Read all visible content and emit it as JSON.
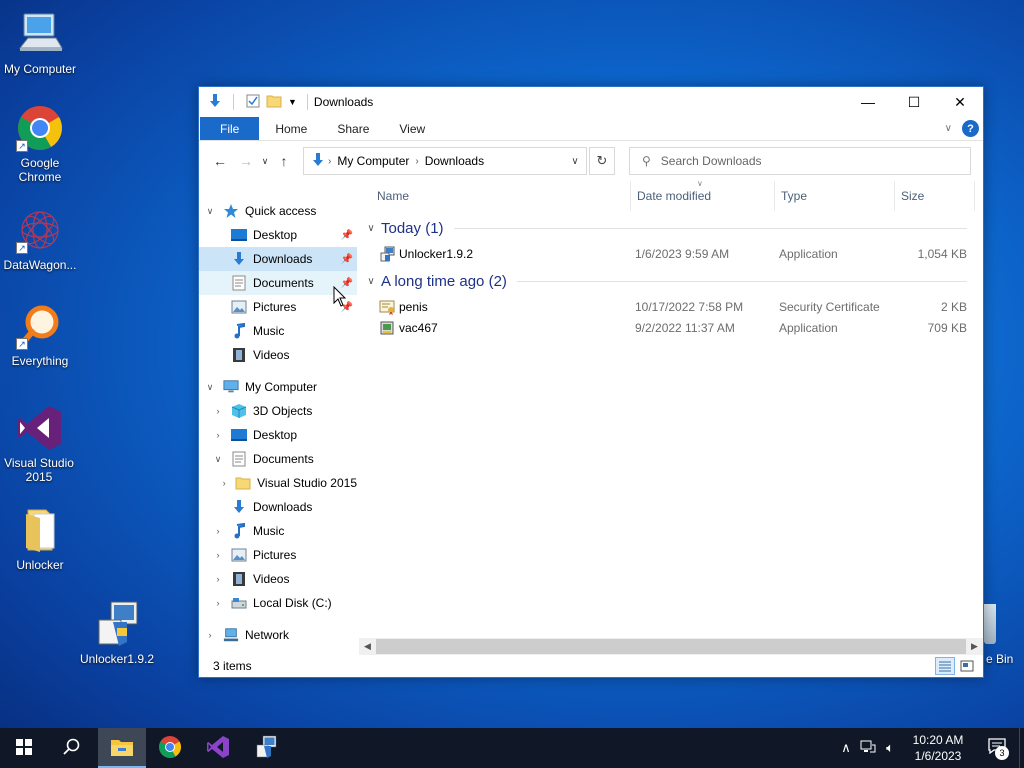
{
  "desktop": {
    "icons": [
      {
        "label": "My Computer"
      },
      {
        "label": "Google Chrome"
      },
      {
        "label": "DataWagon..."
      },
      {
        "label": "Everything"
      },
      {
        "label": "Visual Studio 2015"
      },
      {
        "label": "Unlocker"
      },
      {
        "label": "Unlocker1.9.2"
      }
    ],
    "recycle_bin_label": "e Bin"
  },
  "window": {
    "title": "Downloads",
    "controls": {
      "minimize": "—",
      "maximize": "☐",
      "close": "✕"
    },
    "ribbon_tabs": [
      "File",
      "Home",
      "Share",
      "View"
    ],
    "address": {
      "crumbs": [
        "My Computer",
        "Downloads"
      ]
    },
    "search": {
      "placeholder": "Search Downloads"
    },
    "columns": {
      "name": "Name",
      "date": "Date modified",
      "type": "Type",
      "size": "Size"
    },
    "groups": [
      {
        "title": "Today (1)",
        "files": [
          {
            "name": "Unlocker1.9.2",
            "date": "1/6/2023 9:59 AM",
            "type": "Application",
            "size": "1,054 KB",
            "icon": "installer-icon"
          }
        ]
      },
      {
        "title": "A long time ago (2)",
        "files": [
          {
            "name": "penis",
            "date": "10/17/2022 7:58 PM",
            "type": "Security Certificate",
            "size": "2 KB",
            "icon": "certificate-icon"
          },
          {
            "name": "vac467",
            "date": "9/2/2022 11:37 AM",
            "type": "Application",
            "size": "709 KB",
            "icon": "application-icon"
          }
        ]
      }
    ],
    "nav": {
      "quick_access": "Quick access",
      "quick_items": [
        "Desktop",
        "Downloads",
        "Documents",
        "Pictures",
        "Music",
        "Videos"
      ],
      "my_computer": "My Computer",
      "pc_items": [
        "3D Objects",
        "Desktop",
        "Documents",
        "Visual Studio 2015",
        "Downloads",
        "Music",
        "Pictures",
        "Videos",
        "Local Disk (C:)"
      ],
      "network": "Network"
    },
    "status": "3 items"
  },
  "taskbar": {
    "time": "10:20 AM",
    "date": "1/6/2023",
    "notification_count": "3"
  },
  "colors": {
    "accent": "#1a6ac9",
    "selection": "#cce4f7",
    "group_header": "#1e3287",
    "taskbar": "#101827"
  }
}
